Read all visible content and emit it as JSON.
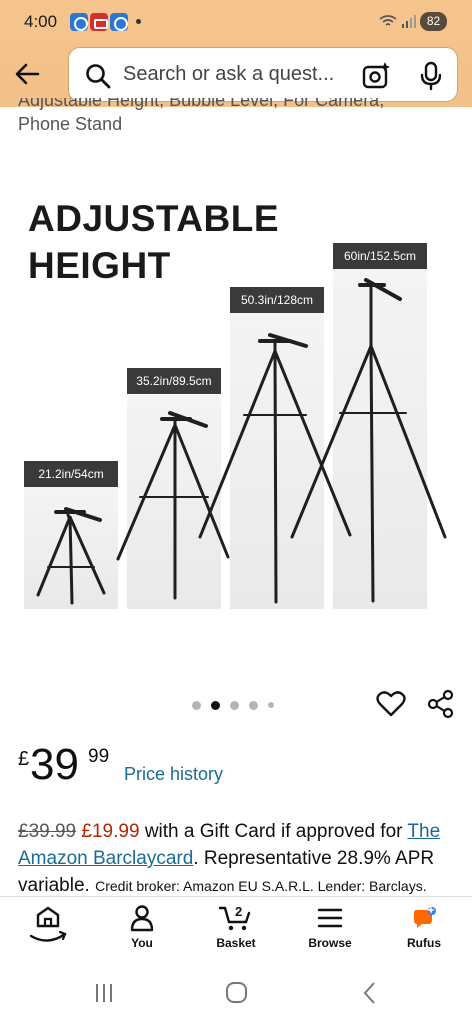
{
  "status_bar": {
    "time": "4:00",
    "battery": "82"
  },
  "search": {
    "placeholder": "Search or ask a quest..."
  },
  "product": {
    "title_line1": "Adjustable Height, Bubble Level, For Camera,",
    "title_line2": "Phone Stand",
    "image": {
      "headline_line1": "ADJUSTABLE",
      "headline_line2": "HEIGHT",
      "heights": [
        "21.2in/54cm",
        "35.2in/89.5cm",
        "50.3in/128cm",
        "60in/152.5cm"
      ]
    },
    "carousel": {
      "count": 5,
      "active_index": 1
    },
    "price": {
      "currency": "£",
      "whole": "39",
      "fraction": "99"
    },
    "price_history_label": "Price history",
    "offer": {
      "old_price": "£39.99",
      "new_price": "£19.99",
      "text1": "with a Gift Card if approved for",
      "card_link": "The Amazon Barclaycard",
      "text2": ". Representative 28.9% APR",
      "text3": "variable.",
      "fine_print": "Credit broker: Amazon EU S.A.R.L. Lender: Barclays. T&Cs"
    }
  },
  "bottom_nav": {
    "items": [
      {
        "label": "",
        "icon": "home-icon"
      },
      {
        "label": "You",
        "icon": "person-icon"
      },
      {
        "label": "Basket",
        "icon": "cart-icon",
        "badge": "2"
      },
      {
        "label": "Browse",
        "icon": "menu-icon"
      },
      {
        "label": "Rufus",
        "icon": "rufus-icon"
      }
    ]
  },
  "colors": {
    "header": "#f5c58d",
    "link": "#1b6b92",
    "sale": "#b12704",
    "rufus": "#ff6a00"
  }
}
